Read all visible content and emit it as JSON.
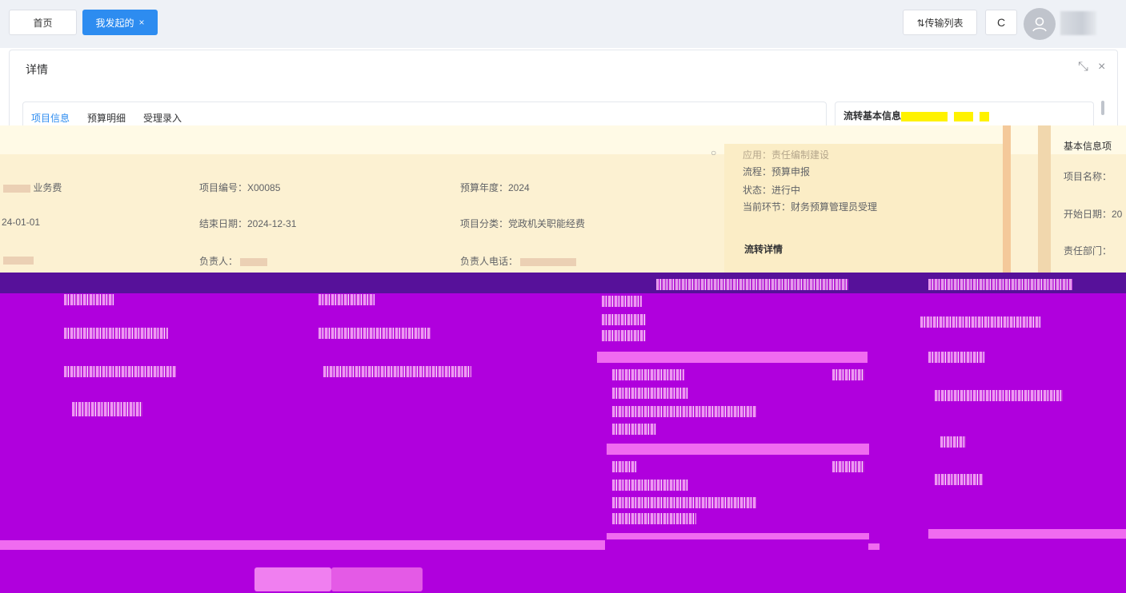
{
  "topbar": {
    "tab_home": "首页",
    "tab_active": "我发起的",
    "tab_close": "×",
    "transfer_list": "⇅传输列表",
    "refresh": "C"
  },
  "panel": {
    "title": "详情",
    "shrink": "⤡",
    "close": "×"
  },
  "subtabs": [
    "项目信息",
    "预算明细",
    "受理录入"
  ],
  "flow": {
    "header": "流转基本信息",
    "applicant_label": "应用：",
    "applicant_value": "责任编制建设",
    "process": "流程：预算申报",
    "status": "状态：进行中",
    "current_step": "当前环节：财务预算管理员受理",
    "details_title": "流转详情"
  },
  "project": {
    "type_suffix": "业务费",
    "code": "项目编号：X00085",
    "budget_year": "预算年度：2024",
    "start_date_partial": "24-01-01",
    "end_date": "结束日期：2024-12-31",
    "category": "项目分类：党政机关职能经费",
    "owner_label": "负责人：",
    "owner_phone_label": "负责人电话："
  },
  "side_basic": {
    "title": "基本信息项",
    "name_label": "项目名称：",
    "start_label": "开始日期：20",
    "dept_label": "责任部门："
  },
  "colors": {
    "primary": "#2d8cf0",
    "warm_band": "#fcf1d2",
    "corrupt_magenta": "#b000dd",
    "corrupt_dark": "#57119a"
  }
}
